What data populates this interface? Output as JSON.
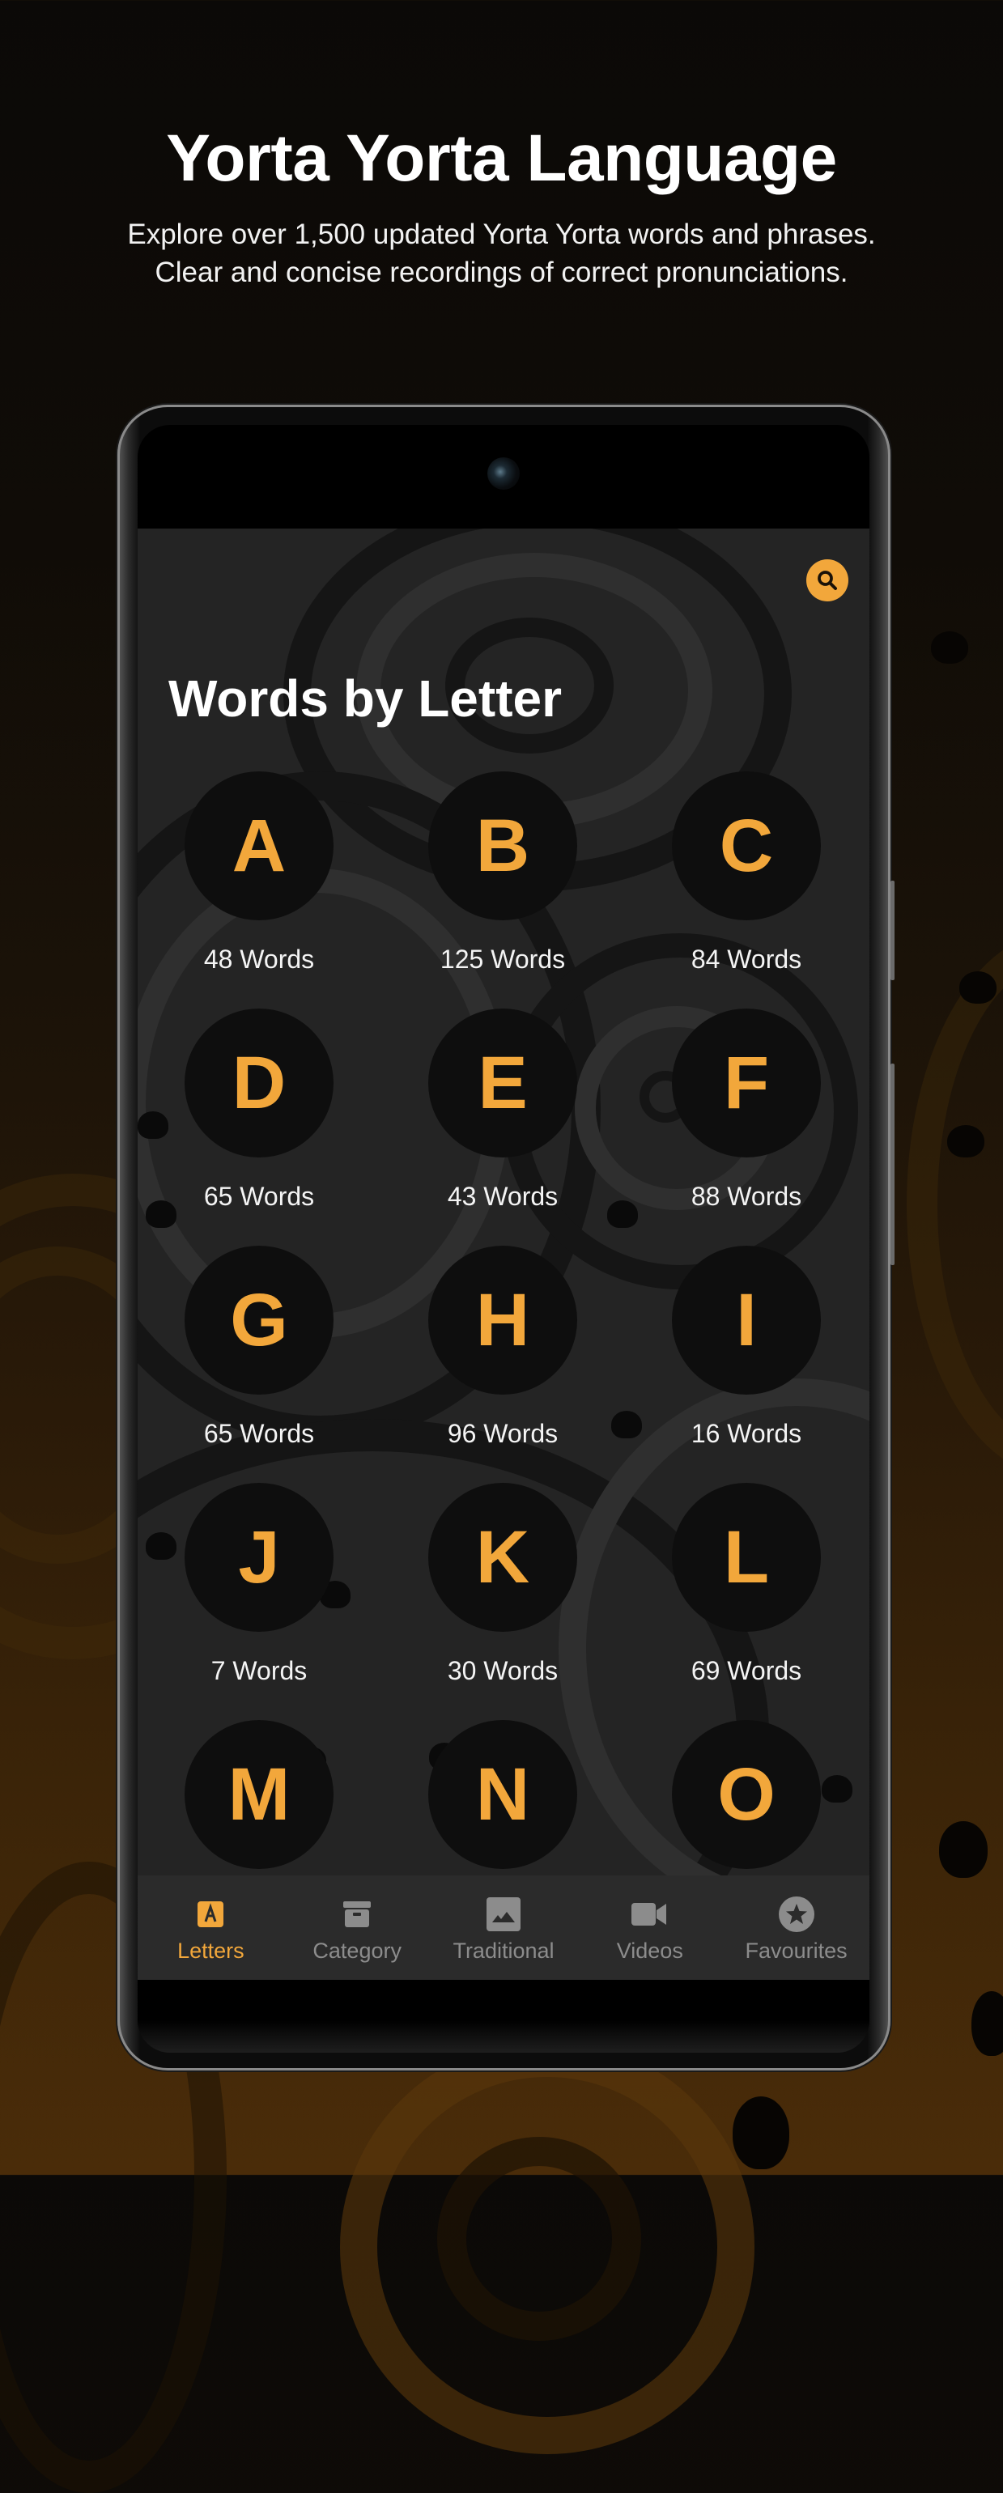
{
  "promo": {
    "title": "Yorta Yorta Language",
    "subtitle_line1": "Explore over 1,500 updated Yorta Yorta words and phrases.",
    "subtitle_line2": "Clear and concise recordings of correct pronunciations."
  },
  "app": {
    "search_icon": "search-icon",
    "title": "Words by Letter",
    "accent_color": "#F2A73B",
    "letters": [
      {
        "letter": "A",
        "count": "48 Words"
      },
      {
        "letter": "B",
        "count": "125 Words"
      },
      {
        "letter": "C",
        "count": "84 Words"
      },
      {
        "letter": "D",
        "count": "65 Words"
      },
      {
        "letter": "E",
        "count": "43 Words"
      },
      {
        "letter": "F",
        "count": "88 Words"
      },
      {
        "letter": "G",
        "count": "65 Words"
      },
      {
        "letter": "H",
        "count": "96 Words"
      },
      {
        "letter": "I",
        "count": "16 Words"
      },
      {
        "letter": "J",
        "count": "7 Words"
      },
      {
        "letter": "K",
        "count": "30 Words"
      },
      {
        "letter": "L",
        "count": "69 Words"
      },
      {
        "letter": "M",
        "count": null
      },
      {
        "letter": "N",
        "count": null
      },
      {
        "letter": "O",
        "count": null
      }
    ],
    "nav": [
      {
        "label": "Letters",
        "icon": "letter-a-icon",
        "active": true
      },
      {
        "label": "Category",
        "icon": "archive-box-icon",
        "active": false
      },
      {
        "label": "Traditional",
        "icon": "image-icon",
        "active": false
      },
      {
        "label": "Videos",
        "icon": "video-camera-icon",
        "active": false
      },
      {
        "label": "Favourites",
        "icon": "star-circle-icon",
        "active": false
      }
    ]
  }
}
